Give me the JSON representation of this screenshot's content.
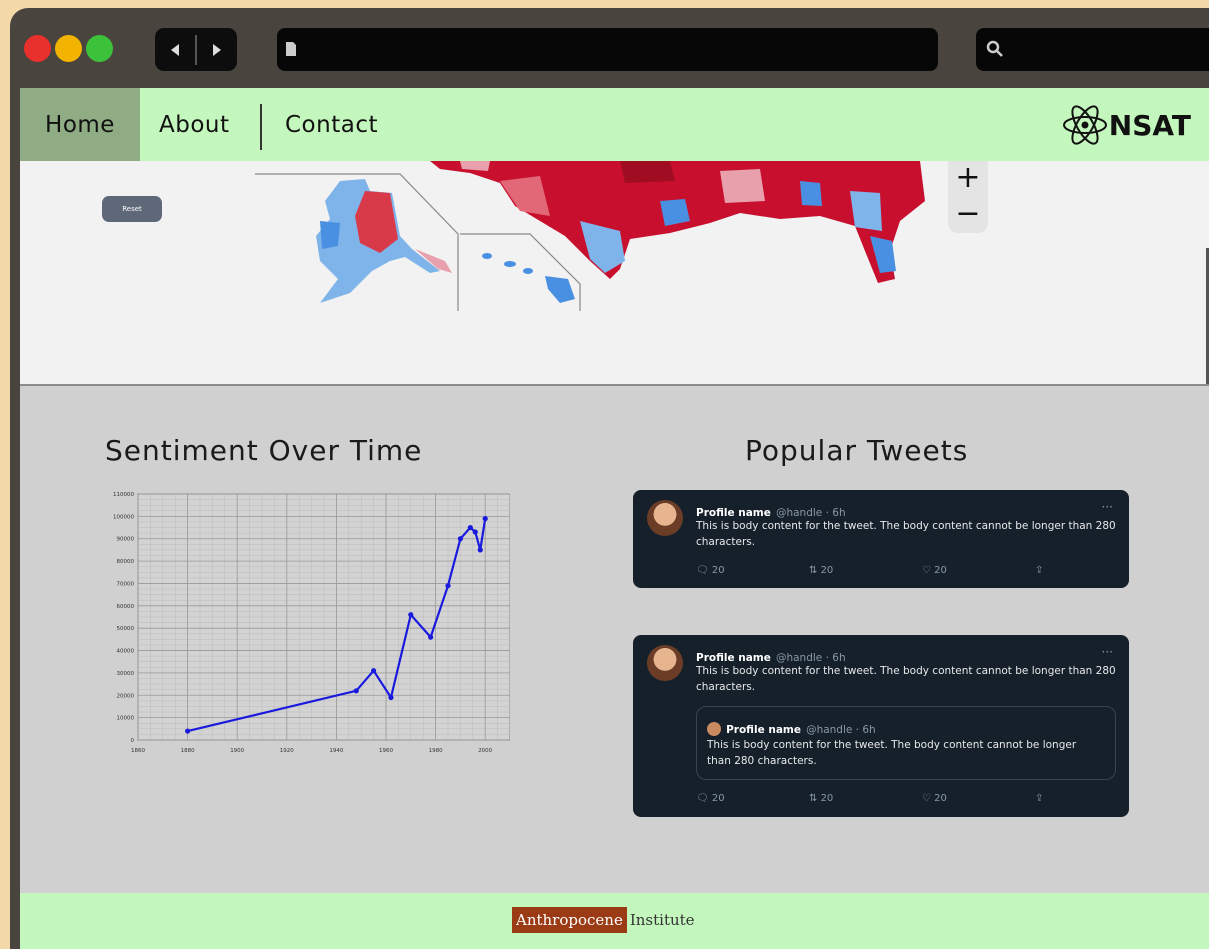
{
  "nav": {
    "home": "Home",
    "about": "About",
    "contact": "Contact",
    "brand": "NSAT"
  },
  "map": {
    "reset_label": "Reset",
    "zoom_in": "+",
    "zoom_out": "−"
  },
  "sentiment": {
    "title": "Sentiment Over Time"
  },
  "tweets": {
    "title": "Popular Tweets",
    "items": [
      {
        "name": "Profile name",
        "handle": "@handle · 6h",
        "body": "This is body content for the tweet. The body content cannot be longer than 280 characters.",
        "replies": "20",
        "retweets": "20",
        "likes": "20"
      },
      {
        "name": "Profile name",
        "handle": "@handle · 6h",
        "body": "This is body content for the tweet. The body content cannot be longer than 280 characters.",
        "quote": {
          "name": "Profile name",
          "handle": "@handle · 6h",
          "body": "This is body content for the tweet. The body content cannot be longer than 280 characters."
        },
        "replies": "20",
        "retweets": "20",
        "likes": "20"
      }
    ]
  },
  "footer": {
    "logo_mark": "Anthropocene",
    "logo_rest": "Institute"
  },
  "colors": {
    "nav_bg": "#c4f7bd",
    "nav_active": "#8fac84",
    "map_red": "#c8102e",
    "map_blue": "#4a90e2",
    "line": "#1a1adf",
    "tweet_bg": "#15202b",
    "logo_box": "#9b3b15"
  },
  "chart_data": {
    "type": "line",
    "x": [
      1880,
      1948,
      1955,
      1962,
      1970,
      1978,
      1985,
      1990,
      1994,
      1996,
      1998,
      2000
    ],
    "values": [
      4000,
      22000,
      31000,
      19000,
      56000,
      46000,
      69000,
      90000,
      95000,
      93000,
      85000,
      99000
    ],
    "xlim": [
      1860,
      2010
    ],
    "ylim": [
      0,
      110000
    ],
    "yticks": [
      "0",
      "10000",
      "20000",
      "30000",
      "40000",
      "50000",
      "60000",
      "70000",
      "80000",
      "90000",
      "100000",
      "110000"
    ],
    "xticks": [
      "1860",
      "1880",
      "1900",
      "1920",
      "1940",
      "1960",
      "1980",
      "2000"
    ],
    "grid": true,
    "title": "",
    "xlabel": "",
    "ylabel": ""
  }
}
